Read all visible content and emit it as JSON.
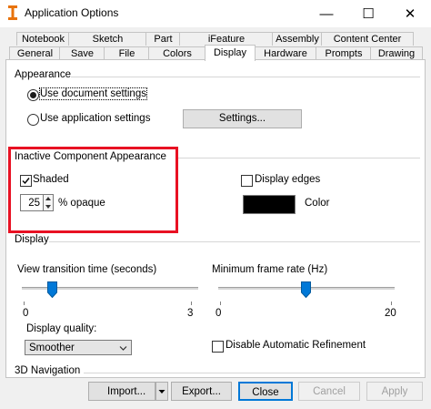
{
  "window": {
    "title": "Application Options",
    "minimize_glyph": "—",
    "maximize_glyph": "☐",
    "close_glyph": "✕"
  },
  "tabs": {
    "row1": [
      "Notebook",
      "Sketch",
      "Part",
      "iFeature",
      "Assembly",
      "Content Center"
    ],
    "row2": [
      "General",
      "Save",
      "File",
      "Colors",
      "Display",
      "Hardware",
      "Prompts",
      "Drawing"
    ],
    "selected": "Display"
  },
  "appearance": {
    "group_label": "Appearance",
    "use_document_settings": "Use document settings",
    "use_application_settings": "Use application settings",
    "selected_option": "use_document_settings",
    "settings_button": "Settings..."
  },
  "inactive": {
    "group_label": "Inactive Component Appearance",
    "shaded_label": "Shaded",
    "shaded_checked": true,
    "opacity_value": "25",
    "opacity_label": "% opaque",
    "display_edges_label": "Display edges",
    "display_edges_checked": false,
    "color_label": "Color",
    "color_value": "#000000"
  },
  "display": {
    "group_label": "Display",
    "view_transition_label": "View transition time (seconds)",
    "view_transition_min": "0",
    "view_transition_max": "3",
    "view_transition_value": 0.5,
    "min_frame_rate_label": "Minimum frame rate (Hz)",
    "min_frame_rate_min": "0",
    "min_frame_rate_max": "20",
    "min_frame_rate_value": 10,
    "display_quality_label": "Display quality:",
    "display_quality_value": "Smoother",
    "disable_refinement_label": "Disable Automatic Refinement",
    "disable_refinement_checked": false
  },
  "navigation": {
    "group_label": "3D Navigation"
  },
  "footer": {
    "import_button": "Import...",
    "export_button": "Export...",
    "close_button": "Close",
    "cancel_button": "Cancel",
    "apply_button": "Apply"
  },
  "colors": {
    "highlight": "#e81123",
    "accent": "#0078d7",
    "slider_thumb": "#0078d7"
  }
}
